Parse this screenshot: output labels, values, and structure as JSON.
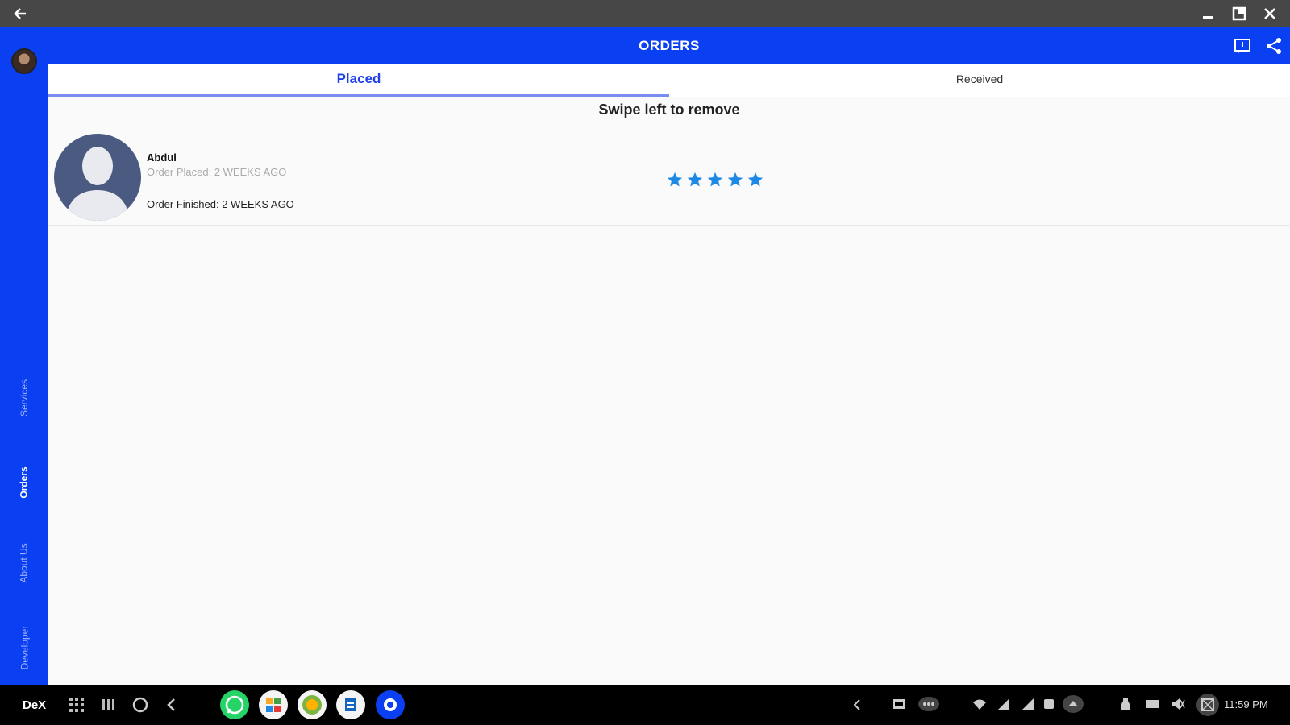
{
  "app": {
    "title": "ORDERS",
    "accent": "#0b3ff2",
    "star_color": "#1e88e5"
  },
  "rail": {
    "items": [
      {
        "label": "Services"
      },
      {
        "label": "Orders"
      },
      {
        "label": "About Us"
      },
      {
        "label": "Developer"
      }
    ],
    "active": "Orders"
  },
  "tabs": [
    {
      "label": "Placed"
    },
    {
      "label": "Received"
    }
  ],
  "hint": "Swipe left to remove",
  "orders": [
    {
      "name": "Abdul",
      "placed": "Order Placed: 2 WEEKS AGO",
      "finished": "Order Finished: 2 WEEKS AGO",
      "rating": 5
    }
  ],
  "taskbar": {
    "brand": "DeX",
    "clock": "11:59 PM"
  },
  "icons": [
    "back-arrow-icon",
    "minimize-icon",
    "maximize-icon",
    "close-icon",
    "feedback-icon",
    "share-icon",
    "star-icon",
    "apps-grid-icon",
    "recents-icon",
    "home-icon",
    "nav-back-icon",
    "whatsapp-icon",
    "gallery-icon",
    "app-icon",
    "tools-icon",
    "dex-app-icon",
    "chevron-left-icon",
    "screenshot-icon",
    "more-icon",
    "wifi-icon",
    "signal-icon",
    "battery-icon",
    "notification-icon",
    "mute-icon",
    "dex-mode-icon"
  ]
}
